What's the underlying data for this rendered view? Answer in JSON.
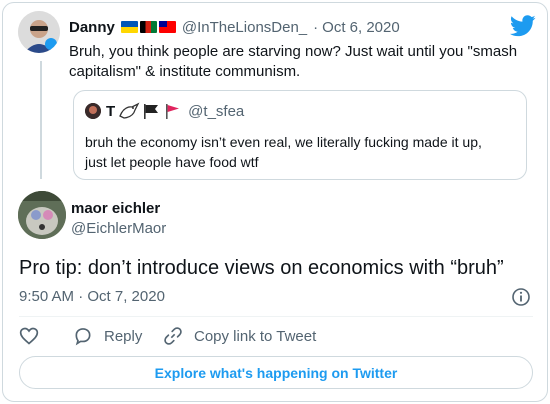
{
  "parent_tweet": {
    "name": "Danny",
    "handle": "@InTheLionsDen_",
    "separator": "·",
    "date": "Oct 6, 2020",
    "text_line1": "Bruh, you think people are starving now? Just wait until you \"smash",
    "text_line2": "capitalism\" & institute communism."
  },
  "quoted_tweet": {
    "name": "T",
    "handle": "@t_sfea",
    "text_line1": "bruh the economy isn’t even real, we literally fucking made it up,",
    "text_line2": "just let people have food wtf"
  },
  "main_tweet": {
    "name": "maor eichler",
    "handle": "@EichlerMaor",
    "text": "Pro tip: don’t introduce views on economics with “bruh”",
    "time": "9:50 AM · Oct 7, 2020"
  },
  "actions": {
    "reply_label": "Reply",
    "copy_link_label": "Copy link to Tweet"
  },
  "footer": {
    "explore_label": "Explore what's happening on Twitter"
  },
  "colors": {
    "accent": "#1d9bf0",
    "muted": "#536471",
    "border": "#cfd9de"
  }
}
